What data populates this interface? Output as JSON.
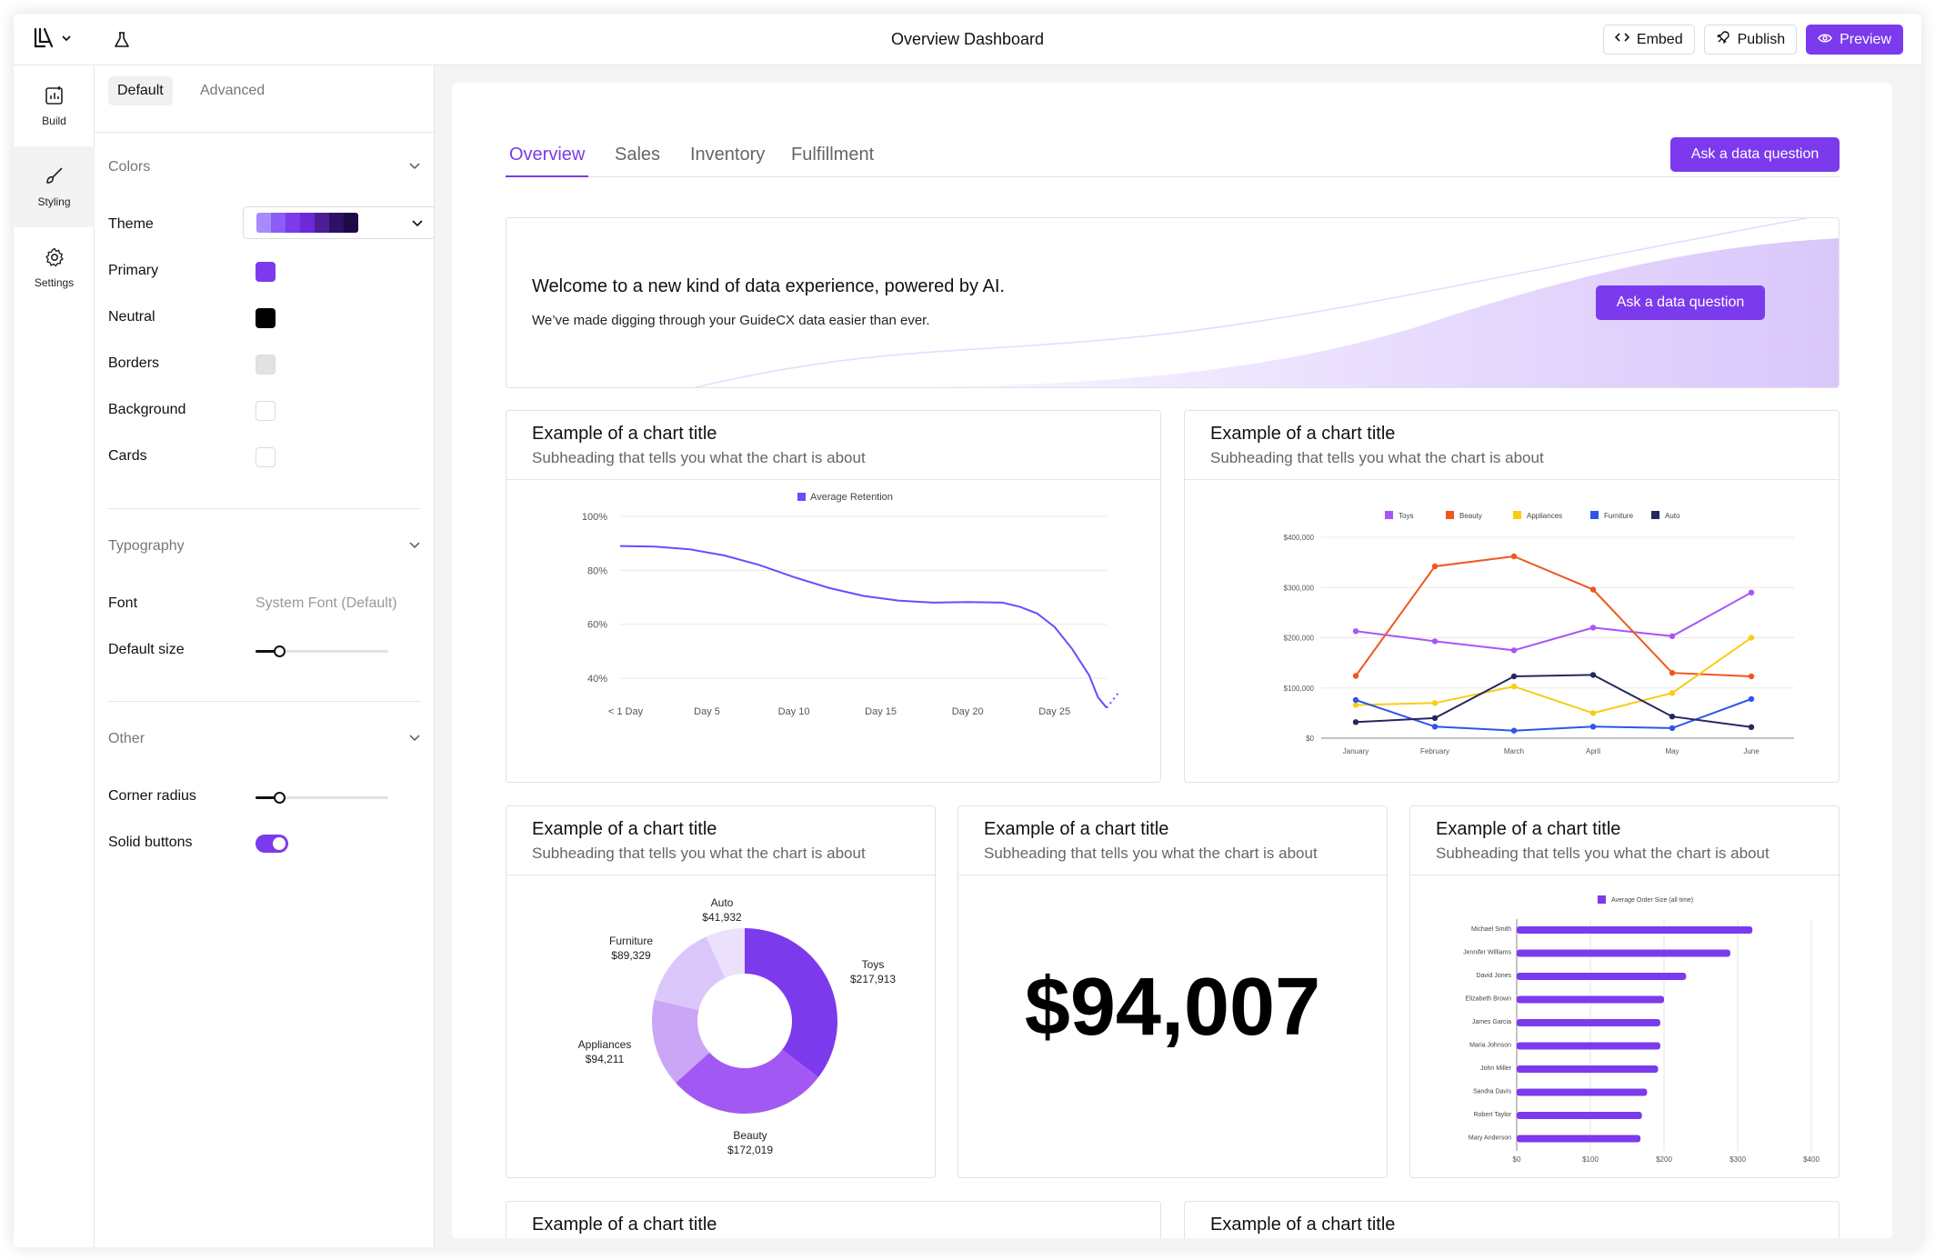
{
  "topbar": {
    "title": "Overview Dashboard",
    "logo_icon": "brand-logo-icon",
    "embed_label": "Embed",
    "publish_label": "Publish",
    "preview_label": "Preview"
  },
  "rail": {
    "items": [
      {
        "label": "Build",
        "icon": "build-chart-icon"
      },
      {
        "label": "Styling",
        "icon": "brush-icon"
      },
      {
        "label": "Settings",
        "icon": "gear-icon"
      }
    ],
    "active": "Styling"
  },
  "panel": {
    "tabs": [
      "Default",
      "Advanced"
    ],
    "active_tab": "Default",
    "colors": {
      "heading": "Colors",
      "theme_label": "Theme",
      "theme_strip": [
        "#a78bfa",
        "#8b5cf6",
        "#7c3aed",
        "#6d28d9",
        "#4c1d95",
        "#2e1065",
        "#1e0a45"
      ],
      "rows": [
        {
          "label": "Primary",
          "color": "#7c3aed"
        },
        {
          "label": "Neutral",
          "color": "#000000"
        },
        {
          "label": "Borders",
          "color": "#e2e2e2"
        },
        {
          "label": "Background",
          "color": "#ffffff"
        },
        {
          "label": "Cards",
          "color": "#ffffff"
        }
      ]
    },
    "typography": {
      "heading": "Typography",
      "font_label": "Font",
      "font_value": "System Font (Default)",
      "size_label": "Default size",
      "size_level": 0.18
    },
    "other": {
      "heading": "Other",
      "radius_label": "Corner radius",
      "radius_level": 0.18,
      "solid_label": "Solid buttons",
      "solid_on": true
    }
  },
  "dashboard": {
    "tabs": [
      "Overview",
      "Sales",
      "Inventory",
      "Fulfillment"
    ],
    "active_tab": "Overview",
    "ask_label": "Ask a data question",
    "hero": {
      "title": "Welcome to a new kind of data experience, powered by AI.",
      "subtitle": "We’ve made digging through your GuideCX data easier than ever.",
      "button": "Ask a data question"
    },
    "card_title": "Example of a chart title",
    "card_subtitle": "Subheading that tells you what the chart is about",
    "kpi_value": "$94,007",
    "bottom_titles": [
      "Example of a chart title",
      "Example of a chart title"
    ]
  },
  "chart_data": [
    {
      "type": "line",
      "legend": [
        "Average Retention"
      ],
      "x_ticks": [
        "< 1 Day",
        "Day 5",
        "Day 10",
        "Day 15",
        "Day 20",
        "Day 25"
      ],
      "y_ticks": [
        "100%",
        "80%",
        "60%",
        "40%"
      ],
      "ylim": [
        30,
        100
      ],
      "series": [
        {
          "name": "Average Retention",
          "color": "#6d4aff",
          "x": [
            0,
            2,
            4,
            6,
            8,
            10,
            12,
            14,
            16,
            18,
            20,
            22,
            23,
            24,
            25,
            26,
            27,
            27.5,
            28
          ],
          "values": [
            89,
            88.8,
            87.8,
            85.5,
            82,
            77.5,
            73.5,
            70.5,
            68.8,
            68,
            68.2,
            68,
            66.5,
            64,
            59,
            51,
            41,
            33,
            29
          ]
        }
      ]
    },
    {
      "type": "line",
      "legend": [
        "Toys",
        "Beauty",
        "Appliances",
        "Furniture",
        "Auto"
      ],
      "categories": [
        "January",
        "February",
        "March",
        "April",
        "May",
        "June"
      ],
      "y_ticks": [
        "$400,000",
        "$300,000",
        "$200,000",
        "$100,000",
        "$0"
      ],
      "ylim": [
        0,
        400000
      ],
      "series": [
        {
          "name": "Toys",
          "color": "#a855f7",
          "values": [
            213000,
            193000,
            175000,
            220000,
            203000,
            290000
          ]
        },
        {
          "name": "Beauty",
          "color": "#f0561d",
          "values": [
            124000,
            342000,
            362000,
            296000,
            130000,
            123000
          ]
        },
        {
          "name": "Appliances",
          "color": "#facc15",
          "values": [
            66000,
            70000,
            103000,
            50000,
            90000,
            200000
          ]
        },
        {
          "name": "Furniture",
          "color": "#2f54eb",
          "values": [
            76000,
            23000,
            15000,
            23000,
            20000,
            78000
          ]
        },
        {
          "name": "Auto",
          "color": "#25285e",
          "values": [
            32000,
            40000,
            123000,
            126000,
            43000,
            22000
          ]
        }
      ]
    },
    {
      "type": "pie",
      "series": [
        {
          "name": "Toys",
          "label_value": "$217,913",
          "value": 217913,
          "color": "#7c3aed"
        },
        {
          "name": "Beauty",
          "label_value": "$172,019",
          "value": 172019,
          "color": "#a259f4"
        },
        {
          "name": "Appliances",
          "label_value": "$94,211",
          "value": 94211,
          "color": "#cba6f7"
        },
        {
          "name": "Furniture",
          "label_value": "$89,329",
          "value": 89329,
          "color": "#dcc7fb"
        },
        {
          "name": "Auto",
          "label_value": "$41,932",
          "value": 41932,
          "color": "#ece1fd"
        }
      ]
    },
    {
      "type": "bar",
      "orientation": "horizontal",
      "legend": [
        "Average Order Size (all time)"
      ],
      "categories": [
        "Michael Smith",
        "Jennifer Williams",
        "David Jones",
        "Elizabeth Brown",
        "James Garcia",
        "Maria Johnson",
        "John Miller",
        "Sandra Davis",
        "Robert Taylor",
        "Mary Anderson"
      ],
      "values": [
        320,
        290,
        230,
        200,
        195,
        195,
        192,
        177,
        170,
        168
      ],
      "x_ticks": [
        "$0",
        "$100",
        "$200",
        "$300",
        "$400"
      ],
      "xlim": [
        0,
        400
      ],
      "color": "#7c3aed"
    }
  ]
}
